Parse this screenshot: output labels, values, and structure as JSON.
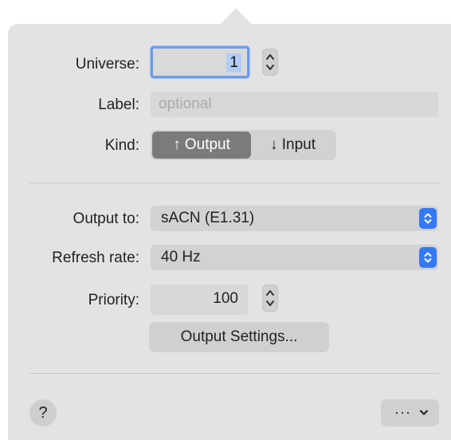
{
  "universe": {
    "label": "Universe:",
    "value": "1"
  },
  "label_field": {
    "label": "Label:",
    "placeholder": "optional"
  },
  "kind": {
    "label": "Kind:",
    "options": [
      {
        "label": "↑ Output",
        "selected": true
      },
      {
        "label": "↓ Input",
        "selected": false
      }
    ]
  },
  "output_to": {
    "label": "Output to:",
    "value": "sACN (E1.31)"
  },
  "refresh_rate": {
    "label": "Refresh rate:",
    "value": "40 Hz"
  },
  "priority": {
    "label": "Priority:",
    "value": "100"
  },
  "output_settings_button": "Output Settings...",
  "help_button": "?",
  "more_button": "···",
  "colors": {
    "popover_bg": "#e3e3e3",
    "accent": "#3478f6",
    "focus_ring": "#6d9be8",
    "selected_segment": "#7b7b7b"
  },
  "icons": [
    "stepper-icon",
    "popup-chevrons-icon",
    "chevron-down-icon",
    "help-icon",
    "more-icon"
  ]
}
